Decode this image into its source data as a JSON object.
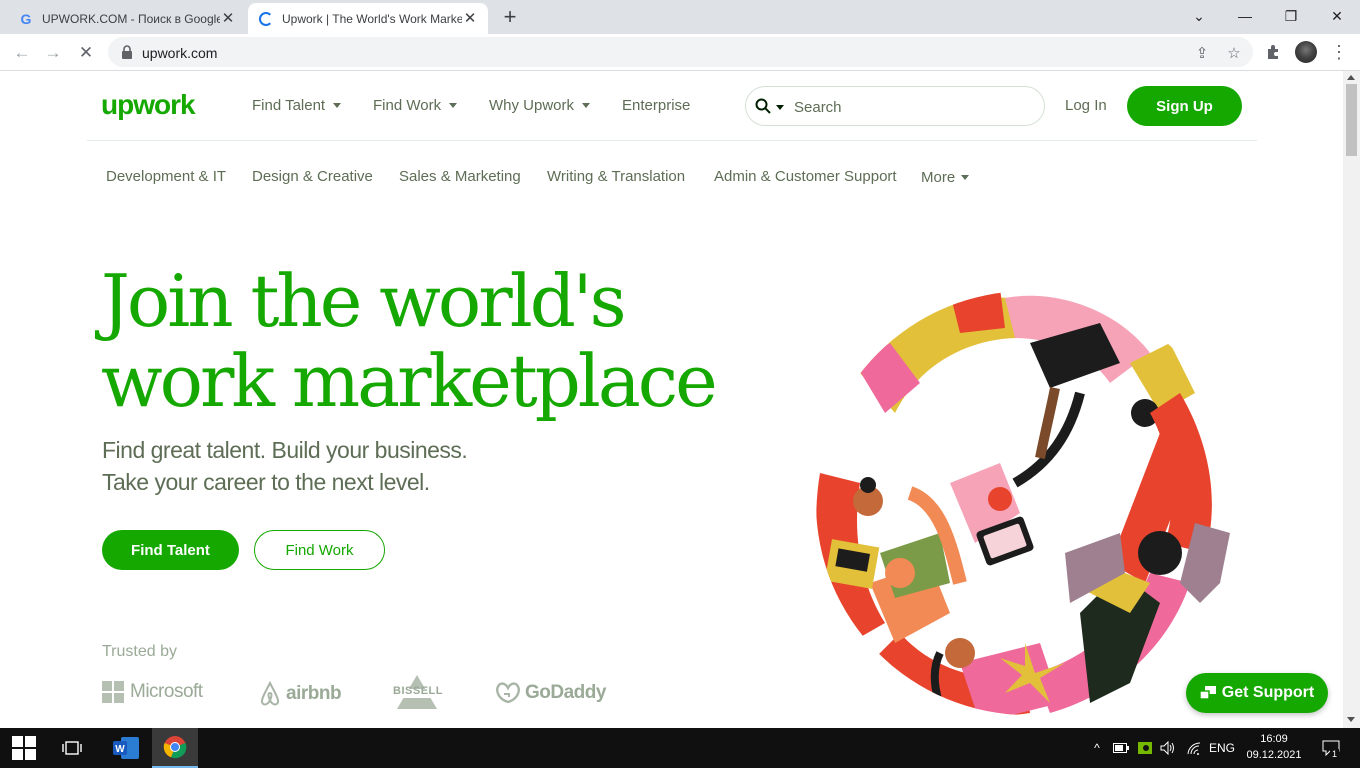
{
  "browser": {
    "tabs": [
      {
        "title": "UPWORK.COM - Поиск в Google",
        "favicon": "google-icon",
        "active": false
      },
      {
        "title": "Upwork | The World's Work Marketplace",
        "favicon": "loading-spinner-icon",
        "active": true
      }
    ],
    "url": "upwork.com"
  },
  "site": {
    "logo": "upwork",
    "nav": {
      "find_talent": "Find Talent",
      "find_work": "Find Work",
      "why_upwork": "Why Upwork",
      "enterprise": "Enterprise"
    },
    "search_placeholder": "Search",
    "login": "Log In",
    "signup": "Sign Up",
    "categories": [
      "Development & IT",
      "Design & Creative",
      "Sales & Marketing",
      "Writing & Translation",
      "Admin & Customer Support",
      "More"
    ],
    "hero": {
      "line1": "Join the world's",
      "line2": "work marketplace",
      "sub1": "Find great talent. Build your business.",
      "sub2": "Take your career to the next level.",
      "cta_primary": "Find Talent",
      "cta_secondary": "Find Work"
    },
    "trusted_by": "Trusted by",
    "brands": [
      "Microsoft",
      "airbnb",
      "Bissell",
      "GoDaddy"
    ],
    "support_button": "Get Support"
  },
  "colors": {
    "brand_green": "#14a800",
    "text_gray": "#5e6d55",
    "logo_gray": "#9aaa97"
  },
  "taskbar": {
    "language": "ENG",
    "time": "16:09",
    "date": "09.12.2021",
    "notification_count": "1"
  }
}
